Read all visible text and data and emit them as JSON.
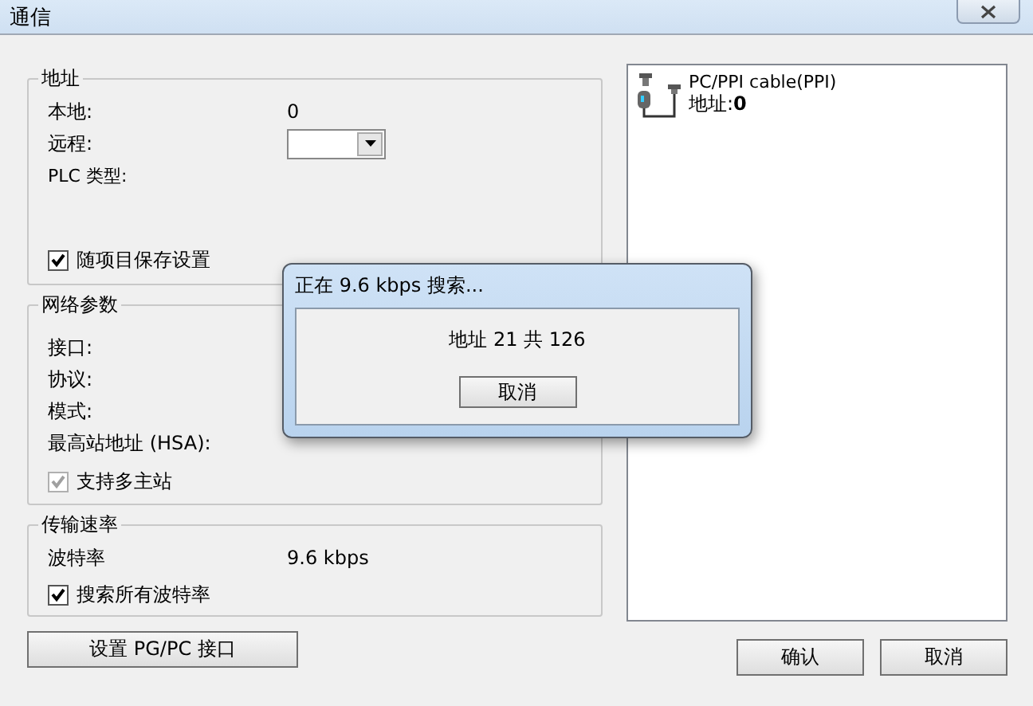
{
  "window": {
    "title": "通信"
  },
  "address_group": {
    "title": "地址",
    "local_label": "本地:",
    "local_value": "0",
    "remote_label": "远程:",
    "plc_type_label": "PLC 类型:",
    "save_checkbox": {
      "label": "随项目保存设置",
      "checked": true,
      "disabled": false
    }
  },
  "network_group": {
    "title": "网络参数",
    "interface_label": "接口:",
    "protocol_label": "协议:",
    "mode_label": "模式:",
    "hsa_label": "最高站地址 (HSA):",
    "multimaster_checkbox": {
      "label": "支持多主站",
      "checked": true,
      "disabled": true
    }
  },
  "rate_group": {
    "title": "传输速率",
    "baud_label": "波特率",
    "baud_value": "9.6 kbps",
    "search_checkbox": {
      "label": "搜索所有波特率",
      "checked": true,
      "disabled": false
    }
  },
  "setup_button": "设置 PG/PC 接口",
  "device": {
    "name": "PC/PPI cable(PPI)",
    "address_label": "地址:",
    "address_value": "0"
  },
  "buttons": [
    "确认",
    "取消"
  ],
  "search_dialog": {
    "title": "正在 9.6 kbps 搜索...",
    "progress_text": "地址 21 共 126",
    "cancel": "取消"
  }
}
